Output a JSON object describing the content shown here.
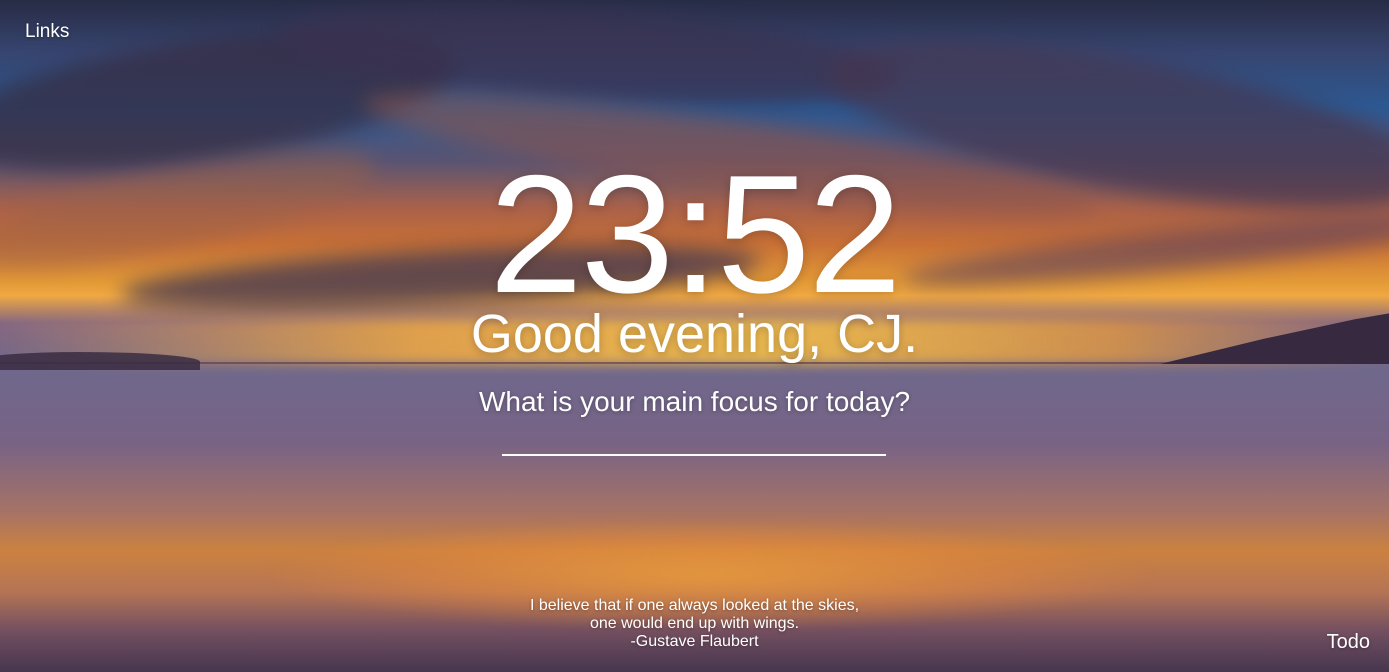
{
  "nav": {
    "links_label": "Links",
    "todo_label": "Todo"
  },
  "clock": {
    "time": "23:52"
  },
  "greeting": {
    "text": "Good evening, CJ."
  },
  "focus": {
    "question": "What is your main focus for today?",
    "input_value": ""
  },
  "quote": {
    "line1": "I believe that if one always looked at the skies,",
    "line2": "one would end up with wings.",
    "author": "-Gustave Flaubert"
  },
  "background": {
    "subject": "ocean sunset with clouds"
  }
}
